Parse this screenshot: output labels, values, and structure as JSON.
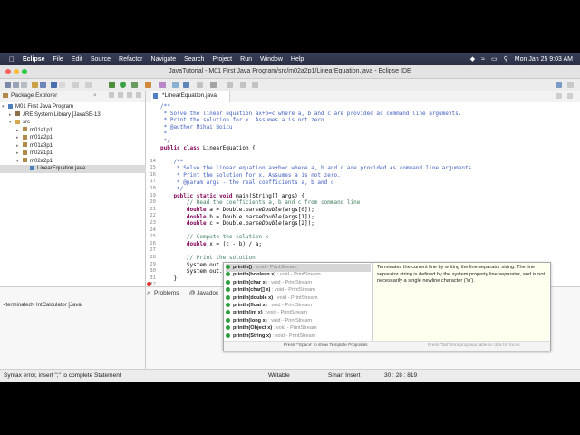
{
  "mac_menu": {
    "apple": "",
    "app": "Eclipse",
    "items": [
      "File",
      "Edit",
      "Source",
      "Refactor",
      "Navigate",
      "Search",
      "Project",
      "Run",
      "Window",
      "Help"
    ],
    "clock": "Mon Jan 25  9:03 AM"
  },
  "window": {
    "title": "JavaTutorial - M01 First Java Program/src/m02a2p1/LinearEquation.java - Eclipse IDE"
  },
  "explorer": {
    "tab_label": "Package Explorer",
    "tree": [
      {
        "text": "M01 First Java Program",
        "depth": 0,
        "icon": "project-icon"
      },
      {
        "text": "JRE System Library [JavaSE-13]",
        "depth": 1,
        "icon": "library-icon"
      },
      {
        "text": "src",
        "depth": 1,
        "icon": "folder-icon"
      },
      {
        "text": "m01a1p1",
        "depth": 2,
        "icon": "package-icon"
      },
      {
        "text": "m01a2p1",
        "depth": 2,
        "icon": "package-icon"
      },
      {
        "text": "m01a3p1",
        "depth": 2,
        "icon": "package-icon"
      },
      {
        "text": "m02a1p1",
        "depth": 2,
        "icon": "package-icon"
      },
      {
        "text": "m02a2p1",
        "depth": 2,
        "icon": "package-icon"
      },
      {
        "text": "LinearEquation.java",
        "depth": 3,
        "icon": "java-file-icon"
      }
    ]
  },
  "editor": {
    "tab_label": "*LinearEquation.java",
    "line_numbers": [
      "",
      "",
      "",
      "",
      "",
      "",
      "14",
      "15",
      "16",
      "17",
      "18",
      "19",
      "20",
      "21",
      "22",
      "23",
      "24",
      "25",
      "26",
      "27",
      "28",
      "29",
      "30",
      "31"
    ],
    "lines": [
      "/**",
      " * Solve the linear equation ax+b=c where a, b and c are provided as command line arguments.",
      " * Print the solution for x. Assumes a is not zero.",
      " * @author Mihai Boicu",
      " *",
      " */",
      "public class LinearEquation {",
      "",
      "    /**",
      "     * Solve the linear equation ax+b=c where a, b and c are provided as command line arguments.",
      "     * Print the solution for x. Assumes a is not zero.",
      "     * @param args - the real coefficients a, b and c",
      "     */",
      "    public static void main(String[] args) {",
      "        // Read the coefficients a, b and c from command line",
      "        double a = Double.parseDouble(args[0]);",
      "        double b = Double.parseDouble(args[1]);",
      "        double c = Double.parseDouble(args[2]);",
      "",
      "        // Compute the solution x",
      "        double x = (c - b) / a;",
      "",
      "        // Print the solution",
      "        System.out.println(\"Solve ax + b = c\");",
      "        System.out.println()",
      "    }"
    ]
  },
  "bottom": {
    "tabs": [
      "Problems",
      "Javadoc"
    ],
    "console_text": "<terminated> IntCalculator [Java",
    "console_tail": "M)"
  },
  "completion": {
    "items": [
      {
        "name": "println()",
        "ret": ": void - PrintStream"
      },
      {
        "name": "println(boolean x)",
        "ret": ": void - PrintStream"
      },
      {
        "name": "println(char x)",
        "ret": ": void - PrintStream"
      },
      {
        "name": "println(char[] x)",
        "ret": ": void - PrintStream"
      },
      {
        "name": "println(double x)",
        "ret": ": void - PrintStream"
      },
      {
        "name": "println(float x)",
        "ret": ": void - PrintStream"
      },
      {
        "name": "println(int x)",
        "ret": ": void - PrintStream"
      },
      {
        "name": "println(long x)",
        "ret": ": void - PrintStream"
      },
      {
        "name": "println(Object x)",
        "ret": ": void - PrintStream"
      },
      {
        "name": "println(String x)",
        "ret": ": void - PrintStream"
      }
    ],
    "doc": "Terminates the current line by writing the line separator string. The line separator string is defined by the system property line.separator, and is not necessarily a single newline character ('\\n').",
    "footer_left": "Press '^Space' to show Template Proposals",
    "footer_right": "Press 'Tab' from proposal table or click for focus"
  },
  "status": {
    "message": "Syntax error, insert \";\" to complete Statement",
    "mode": "Writable",
    "insert": "Smart Insert",
    "position": "30 : 28 : 819"
  }
}
